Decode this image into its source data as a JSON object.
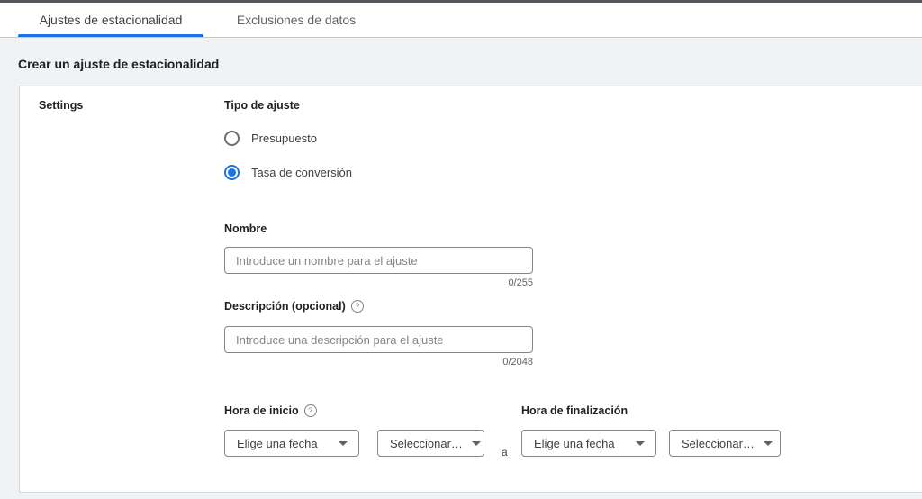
{
  "tabs": [
    {
      "label": "Ajustes de estacionalidad",
      "active": true
    },
    {
      "label": "Exclusiones de datos",
      "active": false
    }
  ],
  "header": {
    "title": "Crear un ajuste de estacionalidad"
  },
  "panel": {
    "section_label": "Settings",
    "adjustment_type": {
      "label": "Tipo de ajuste",
      "options": [
        {
          "label": "Presupuesto",
          "selected": false
        },
        {
          "label": "Tasa de conversión",
          "selected": true
        }
      ]
    },
    "name_field": {
      "label": "Nombre",
      "placeholder": "Introduce un nombre para el ajuste",
      "value": "",
      "counter": "0/255"
    },
    "description_field": {
      "label": "Descripción (opcional)",
      "help_icon": "?",
      "placeholder": "Introduce una descripción para el ajuste",
      "value": "",
      "counter": "0/2048"
    },
    "start_time": {
      "label": "Hora de inicio",
      "help_icon": "?",
      "date_dropdown": "Elige una fecha",
      "time_dropdown": "Seleccionar…"
    },
    "range_separator": "a",
    "end_time": {
      "label": "Hora de finalización",
      "date_dropdown": "Elige una fecha",
      "time_dropdown": "Seleccionar…"
    }
  },
  "colors": {
    "accent_blue": "#1a73e8",
    "workspace_gray": "#f1f2f3",
    "text_dark": "#202124",
    "text_gray": "#5f6368",
    "border_gray": "#80868b"
  }
}
